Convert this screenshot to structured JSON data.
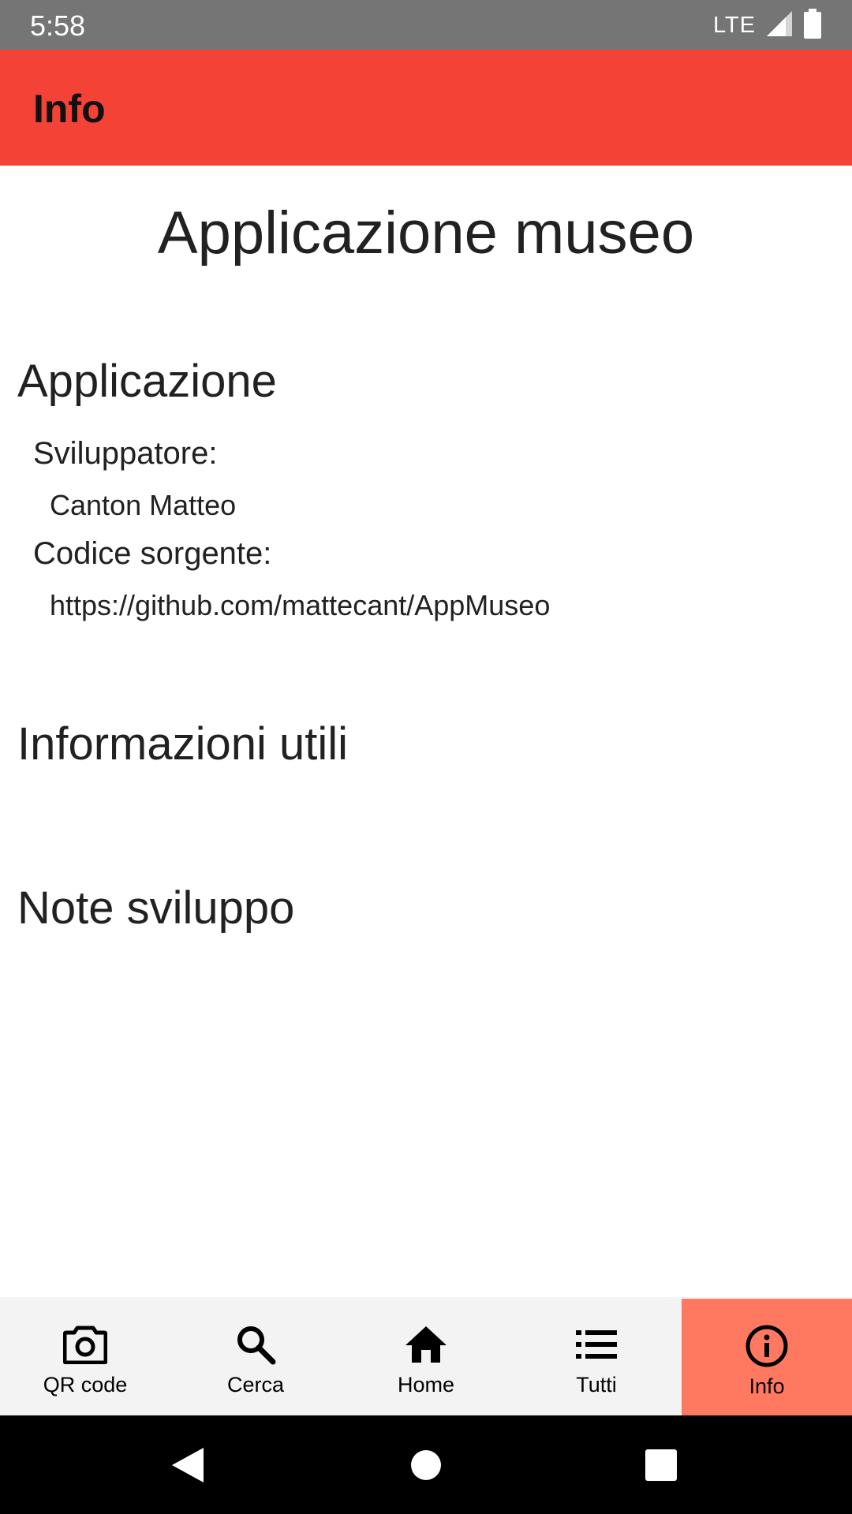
{
  "status_bar": {
    "time": "5:58",
    "network": "LTE",
    "icons": [
      "signal-icon",
      "battery-icon"
    ]
  },
  "app_bar": {
    "title": "Info",
    "color": "#f44336"
  },
  "content": {
    "title": "Applicazione museo",
    "sections": [
      {
        "heading": "Applicazione",
        "fields": [
          {
            "label": "Sviluppatore:",
            "value": "Canton Matteo"
          },
          {
            "label": "Codice sorgente:",
            "value": "https://github.com/mattecant/AppMuseo"
          }
        ]
      },
      {
        "heading": "Informazioni utili"
      },
      {
        "heading": "Note sviluppo"
      }
    ]
  },
  "bottom_nav": {
    "active_color": "#ff7961",
    "items": [
      {
        "label": "QR code",
        "icon": "camera-icon"
      },
      {
        "label": "Cerca",
        "icon": "search-icon"
      },
      {
        "label": "Home",
        "icon": "home-icon"
      },
      {
        "label": "Tutti",
        "icon": "list-icon"
      },
      {
        "label": "Info",
        "icon": "info-icon",
        "selected": true
      }
    ]
  },
  "system_nav": {
    "buttons": [
      "back-icon",
      "home-circle-icon",
      "recents-icon"
    ]
  }
}
